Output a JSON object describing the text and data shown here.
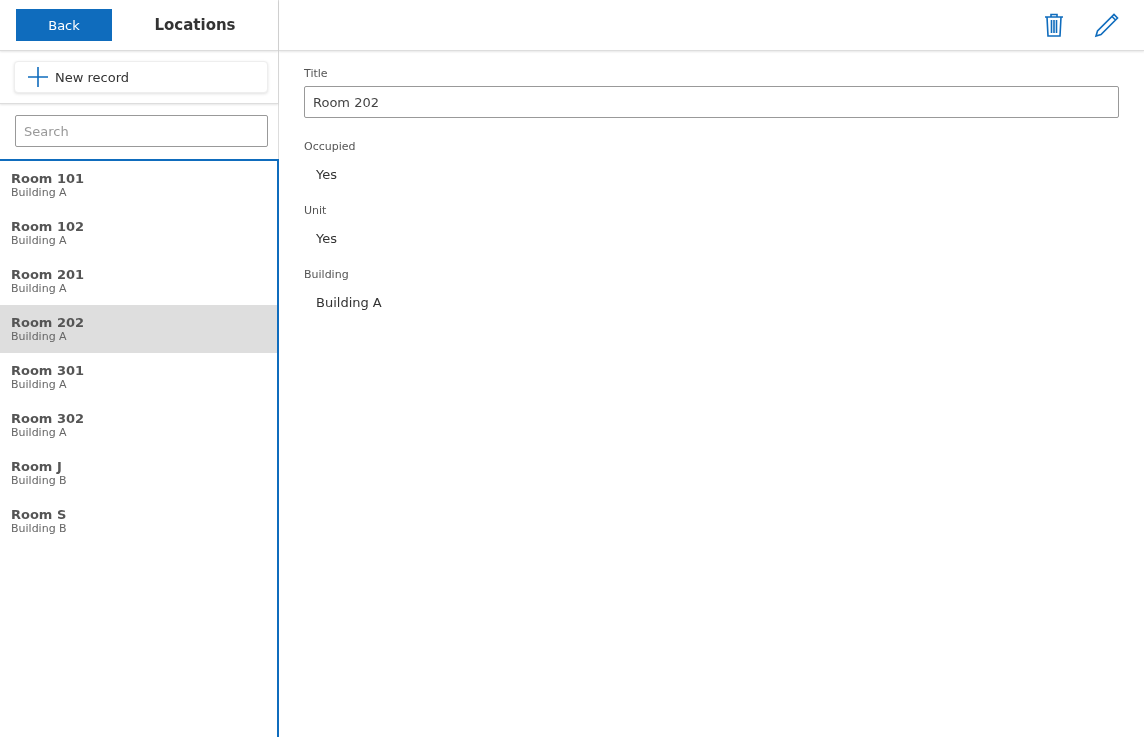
{
  "header": {
    "back_button": "Back",
    "title": "Locations"
  },
  "new_record_button": "New record",
  "search": {
    "placeholder": "Search"
  },
  "records": [
    {
      "title": "Room 101",
      "subtitle": "Building A",
      "selected": false
    },
    {
      "title": "Room 102",
      "subtitle": "Building A",
      "selected": false
    },
    {
      "title": "Room 201",
      "subtitle": "Building A",
      "selected": false
    },
    {
      "title": "Room 202",
      "subtitle": "Building A",
      "selected": true
    },
    {
      "title": "Room 301",
      "subtitle": "Building A",
      "selected": false
    },
    {
      "title": "Room 302",
      "subtitle": "Building A",
      "selected": false
    },
    {
      "title": "Room J",
      "subtitle": "Building B",
      "selected": false
    },
    {
      "title": "Room S",
      "subtitle": "Building B",
      "selected": false
    }
  ],
  "fields": [
    {
      "label": "Title",
      "value": "Room 202",
      "kind": "input"
    },
    {
      "label": "Occupied",
      "value": "Yes",
      "kind": "text"
    },
    {
      "label": "Unit",
      "value": "Yes",
      "kind": "text"
    },
    {
      "label": "Building",
      "value": "Building A",
      "kind": "text"
    }
  ]
}
